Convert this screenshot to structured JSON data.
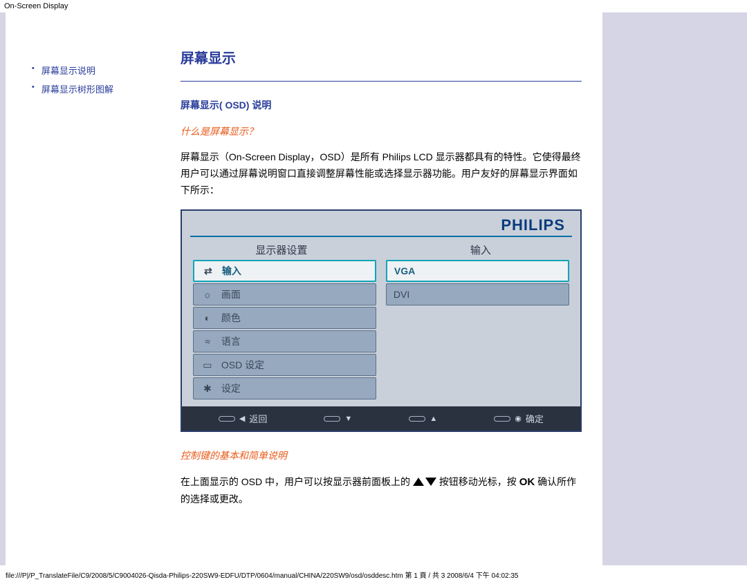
{
  "header": {
    "label": "On-Screen Display"
  },
  "sidebar": {
    "items": [
      {
        "label": "屏幕显示说明"
      },
      {
        "label": "屏幕显示树形图解"
      }
    ]
  },
  "main": {
    "title": "屏幕显示",
    "section_title": "屏幕显示( OSD)  说明",
    "q1": "什么是屏幕显示？",
    "p1": "屏幕显示（On-Screen Display，OSD）是所有 Philips LCD 显示器都具有的特性。它使得最终用户可以通过屏幕说明窗口直接调整屏幕性能或选择显示器功能。用户友好的屏幕显示界面如下所示：",
    "q2": "控制键的基本和简单说明",
    "p2a": "在上面显示的 OSD 中，用户可以按显示器前面板上的 ",
    "p2b": " 按钮移动光标，按 ",
    "p2c": " 确认所作的选择或更改。",
    "ok": "OK"
  },
  "osd": {
    "brand": "PHILIPS",
    "col1_header": "显示器设置",
    "col2_header": "输入",
    "left_items": [
      {
        "icon": "⇄",
        "label": "输入",
        "selected": true
      },
      {
        "icon": "☼",
        "label": "画面"
      },
      {
        "icon": "◐",
        "label": "颜色"
      },
      {
        "icon": "≈",
        "label": "语言"
      },
      {
        "icon": "▭",
        "label": "OSD 设定"
      },
      {
        "icon": "✱",
        "label": "设定"
      }
    ],
    "right_items": [
      {
        "label": "VGA",
        "selected": true
      },
      {
        "label": "DVI"
      }
    ],
    "bottom": {
      "back": "返回",
      "ok": "确定"
    }
  },
  "footer": {
    "text": "file:///P|/P_TranslateFile/C9/2008/5/C9004026-Qisda-Philips-220SW9-EDFU/DTP/0604/manual/CHINA/220SW9/osd/osddesc.htm 第 1 頁 / 共 3 2008/6/4 下午 04:02:35"
  }
}
